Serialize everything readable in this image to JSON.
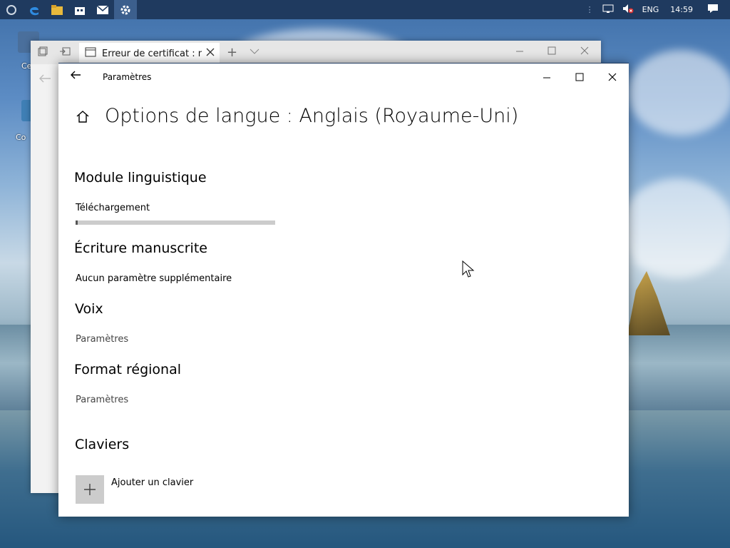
{
  "taskbar": {
    "lang": "ENG",
    "time": "14:59"
  },
  "desktop": {
    "icon_label_1": "Ce",
    "icon_label_2": "Co"
  },
  "browser": {
    "tab_title": "Erreur de certificat : nav"
  },
  "settings": {
    "app_title": "Paramètres",
    "page_title": "Options de langue : Anglais (Royaume-Uni)",
    "sections": {
      "language_pack": "Module linguistique",
      "download_label": "Téléchargement",
      "download_progress": 0.01,
      "handwriting": "Écriture manuscrite",
      "handwriting_note": "Aucun paramètre supplémentaire",
      "voice": "Voix",
      "voice_link": "Paramètres",
      "regional": "Format régional",
      "regional_link": "Paramètres",
      "keyboards": "Claviers",
      "add_keyboard": "Ajouter un clavier"
    }
  },
  "colors": {
    "taskbar": "#1f3a5f",
    "accent_active": "#3c5f8d"
  }
}
